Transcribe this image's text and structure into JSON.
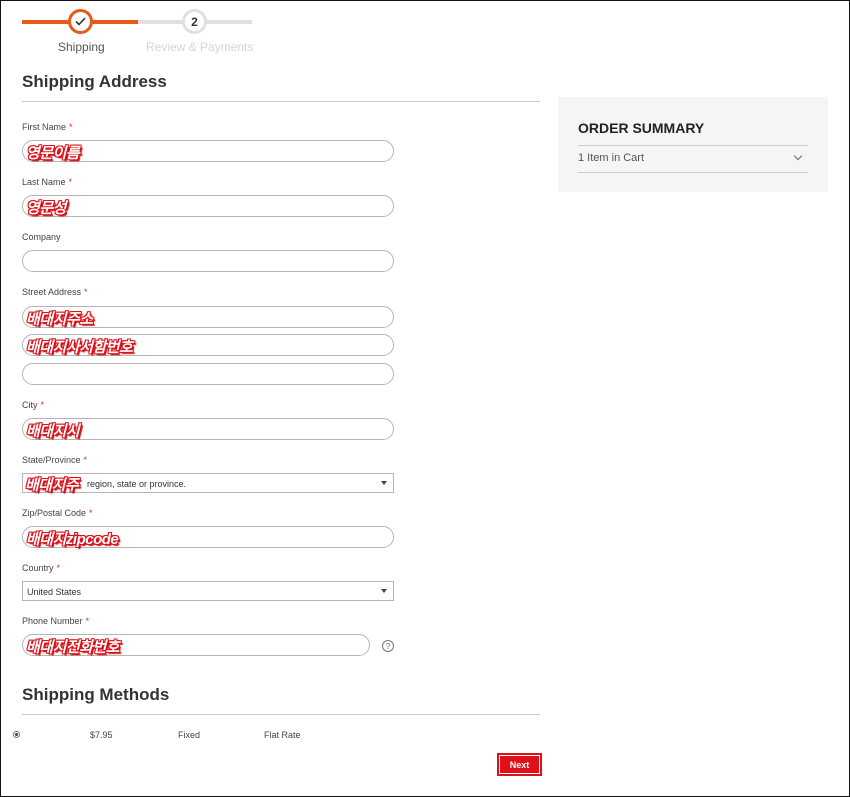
{
  "progress": {
    "steps": [
      {
        "number": "",
        "label": "Shipping",
        "state": "done"
      },
      {
        "number": "2",
        "label": "Review & Payments",
        "state": "pending"
      }
    ],
    "accent_color": "#e75a1b"
  },
  "shipping_address": {
    "title": "Shipping Address",
    "first_name": {
      "label": "First Name",
      "value": "영문이름"
    },
    "last_name": {
      "label": "Last Name",
      "value": "영문성"
    },
    "company": {
      "label": "Company",
      "value": ""
    },
    "street": {
      "label": "Street Address",
      "line1": "배대지주소",
      "line2": "배대지사서함번호",
      "line3": ""
    },
    "city": {
      "label": "City",
      "value": "배대지시"
    },
    "state": {
      "label": "State/Province",
      "value": "배대지주",
      "placeholder_tail": "region, state or province."
    },
    "zip": {
      "label": "Zip/Postal Code",
      "value": "배대지zipcode"
    },
    "country": {
      "label": "Country",
      "value": "United States"
    },
    "phone": {
      "label": "Phone Number",
      "value": "배대지전화번호"
    },
    "required_marker": "*"
  },
  "shipping_methods": {
    "title": "Shipping Methods",
    "rows": [
      {
        "price": "$7.95",
        "method": "Fixed",
        "carrier": "Flat Rate",
        "selected": true
      }
    ]
  },
  "actions": {
    "next_label": "Next"
  },
  "order_summary": {
    "title": "ORDER SUMMARY",
    "items_label": "1 Item in Cart"
  },
  "colors": {
    "brand_red": "#e0101a",
    "progress_orange": "#e75a1b"
  }
}
